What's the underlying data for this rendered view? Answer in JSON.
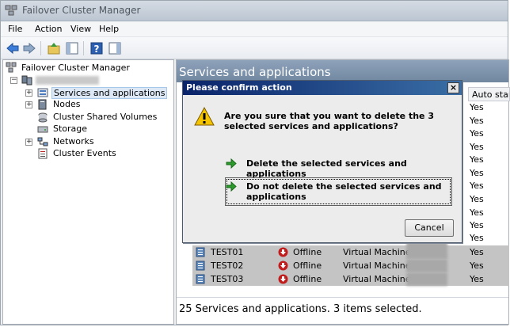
{
  "window": {
    "title": "Failover Cluster Manager"
  },
  "menu": {
    "items": [
      "File",
      "Action",
      "View",
      "Help"
    ]
  },
  "toolbar": {
    "icons": [
      "back-arrow-icon",
      "forward-arrow-icon",
      "up-folder-icon",
      "show-hide-tree-icon",
      "help-icon",
      "action-pane-icon"
    ]
  },
  "tree": {
    "root": "Failover Cluster Manager",
    "children": [
      "Services and applications",
      "Nodes",
      "Cluster Shared Volumes",
      "Storage",
      "Networks",
      "Cluster Events"
    ]
  },
  "main": {
    "title": "Services and applications",
    "column_autostart": "Auto start",
    "autostart_values": [
      "Yes",
      "Yes",
      "Yes",
      "Yes",
      "Yes",
      "Yes",
      "Yes",
      "Yes",
      "Yes",
      "Yes",
      "Yes",
      "Yes",
      "Yes",
      "Yes",
      "Yes",
      "Yes"
    ],
    "selected_rows": [
      {
        "name": "TEST01",
        "status": "Offline",
        "type": "Virtual Machine",
        "autostart": "Yes"
      },
      {
        "name": "TEST02",
        "status": "Offline",
        "type": "Virtual Machine",
        "autostart": "Yes"
      },
      {
        "name": "TEST03",
        "status": "Offline",
        "type": "Virtual Machine",
        "autostart": "Yes"
      }
    ],
    "status_text": "25 Services and applications. 3 items selected."
  },
  "dialog": {
    "title": "Please confirm action",
    "close_label": "×",
    "question": "Are you sure that you want to delete the 3 selected services and applications?",
    "option_delete": "Delete the selected services and applications",
    "option_keep": "Do not delete the selected services and applications",
    "cancel_label": "Cancel"
  }
}
